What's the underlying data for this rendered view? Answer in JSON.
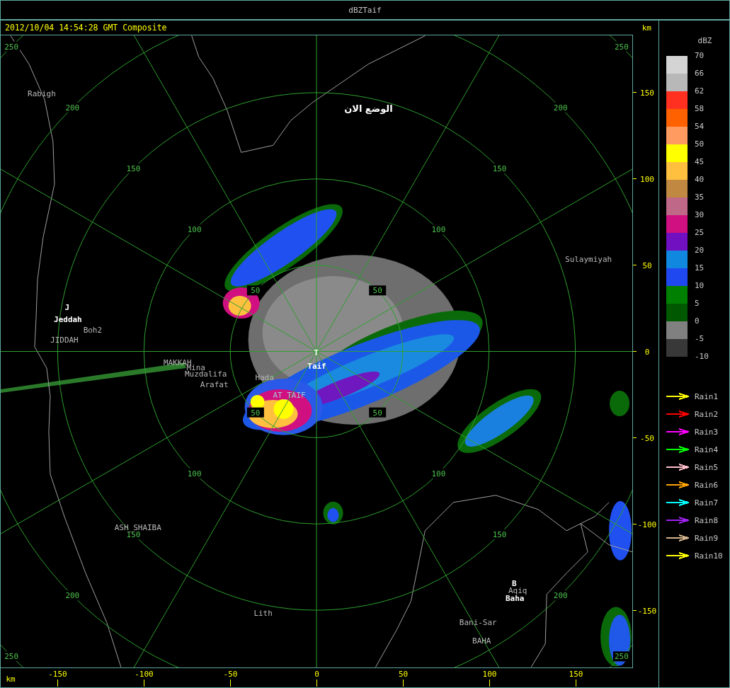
{
  "window": {
    "title": "dBZTaif"
  },
  "header": {
    "timestamp": "2012/10/04 14:54:28 GMT Composite",
    "unit": "km"
  },
  "map": {
    "range_rings": [
      {
        "labels": [
          "50",
          "50",
          "50",
          "50"
        ]
      },
      {
        "labels": [
          "100",
          "100",
          "100",
          "100"
        ]
      },
      {
        "labels": [
          "150",
          "150",
          "150",
          "150"
        ]
      },
      {
        "labels": [
          "200",
          "200",
          "200",
          "200"
        ]
      },
      {
        "labels": [
          "250",
          "250",
          "250",
          "250"
        ]
      }
    ],
    "places": [
      {
        "name": "Rabigh",
        "kind": "site"
      },
      {
        "name": "الوضع الان",
        "kind": "note"
      },
      {
        "name": "Sulaymiyah",
        "kind": "site"
      },
      {
        "name": "J",
        "kind": "city"
      },
      {
        "name": "Jeddah",
        "kind": "city"
      },
      {
        "name": "Boh2",
        "kind": "site"
      },
      {
        "name": "JIDDAH",
        "kind": "site"
      },
      {
        "name": "T",
        "kind": "city"
      },
      {
        "name": "MAKKAH",
        "kind": "site"
      },
      {
        "name": "Mina",
        "kind": "site"
      },
      {
        "name": "Taif",
        "kind": "city"
      },
      {
        "name": "Muzdalifa",
        "kind": "site"
      },
      {
        "name": "Hada",
        "kind": "site"
      },
      {
        "name": "Arafat",
        "kind": "site"
      },
      {
        "name": "AT_TAIF",
        "kind": "radar"
      },
      {
        "name": "ASH_SHAIBA",
        "kind": "site"
      },
      {
        "name": "B",
        "kind": "city"
      },
      {
        "name": "Aqiq",
        "kind": "site"
      },
      {
        "name": "Baha",
        "kind": "city"
      },
      {
        "name": "Lith",
        "kind": "site"
      },
      {
        "name": "Bani-Sar",
        "kind": "site"
      },
      {
        "name": "BAHA",
        "kind": "site"
      }
    ]
  },
  "y_axis": {
    "ticks": [
      "150",
      "100",
      "50",
      "0",
      "-50",
      "-100",
      "-150"
    ]
  },
  "x_axis": {
    "unit": "km",
    "ticks": [
      "-150",
      "-100",
      "-50",
      "0",
      "50",
      "100",
      "150"
    ]
  },
  "legend": {
    "title": "dBZ",
    "levels": [
      {
        "label": "70",
        "color": "#d4d4d4"
      },
      {
        "label": "66",
        "color": "#b8b8b8"
      },
      {
        "label": "62",
        "color": "#ff3020"
      },
      {
        "label": "58",
        "color": "#ff6000"
      },
      {
        "label": "54",
        "color": "#ff9a60"
      },
      {
        "label": "50",
        "color": "#ffff00"
      },
      {
        "label": "45",
        "color": "#ffc040"
      },
      {
        "label": "40",
        "color": "#c08840"
      },
      {
        "label": "35",
        "color": "#c06888"
      },
      {
        "label": "30",
        "color": "#d01080"
      },
      {
        "label": "25",
        "color": "#7010c0"
      },
      {
        "label": "20",
        "color": "#1088e0"
      },
      {
        "label": "15",
        "color": "#2048f0"
      },
      {
        "label": "10",
        "color": "#008000"
      },
      {
        "label": "5",
        "color": "#005800"
      },
      {
        "label": "0",
        "color": "#808080"
      },
      {
        "label": "-5",
        "color": "#383838"
      },
      {
        "label": "-10"
      }
    ],
    "tracks": [
      {
        "label": "Rain1",
        "color": "#ffff00"
      },
      {
        "label": "Rain2",
        "color": "#ff0000"
      },
      {
        "label": "Rain3",
        "color": "#ff00ff"
      },
      {
        "label": "Rain4",
        "color": "#00ff00"
      },
      {
        "label": "Rain5",
        "color": "#ffc0cb"
      },
      {
        "label": "Rain6",
        "color": "#ffa500"
      },
      {
        "label": "Rain7",
        "color": "#00ffff"
      },
      {
        "label": "Rain8",
        "color": "#a020f0"
      },
      {
        "label": "Rain9",
        "color": "#d2b48c"
      },
      {
        "label": "Rain10",
        "color": "#ffff00"
      }
    ]
  }
}
